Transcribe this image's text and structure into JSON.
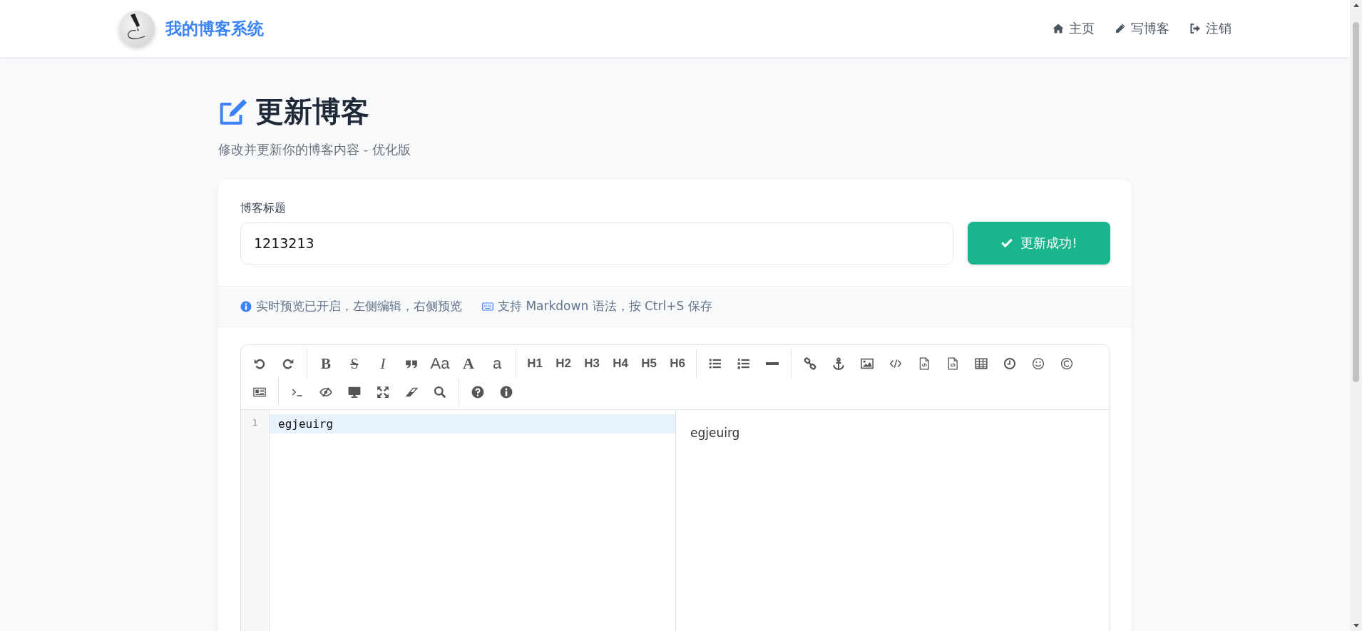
{
  "header": {
    "brand": "我的博客系统",
    "nav": [
      {
        "kind": "home",
        "label": "主页"
      },
      {
        "kind": "pencil",
        "label": "写博客"
      },
      {
        "kind": "signout",
        "label": "注销"
      }
    ]
  },
  "page": {
    "title": "更新博客",
    "subtitle": "修改并更新你的博客内容 - 优化版"
  },
  "form": {
    "title_label": "博客标题",
    "title_value": "1213213",
    "submit_button": "更新成功!"
  },
  "tips": [
    {
      "kind": "info",
      "text": "实时预览已开启，左侧编辑，右侧预览"
    },
    {
      "kind": "keyboard",
      "text": "支持 Markdown 语法，按 Ctrl+S 保存"
    }
  ],
  "editor": {
    "toolbar": [
      [
        {
          "kind": "undo"
        },
        {
          "kind": "redo"
        }
      ],
      [
        {
          "kind": "bold",
          "label": "B"
        },
        {
          "kind": "strike",
          "label": "S"
        },
        {
          "kind": "italic",
          "label": "I"
        },
        {
          "kind": "quote"
        },
        {
          "kind": "text",
          "label": "Aa"
        },
        {
          "kind": "serif",
          "label": "A"
        },
        {
          "kind": "text",
          "label": "a"
        }
      ],
      [
        {
          "kind": "heading",
          "label": "H1"
        },
        {
          "kind": "heading",
          "label": "H2"
        },
        {
          "kind": "heading",
          "label": "H3"
        },
        {
          "kind": "heading",
          "label": "H4"
        },
        {
          "kind": "heading",
          "label": "H5"
        },
        {
          "kind": "heading",
          "label": "H6"
        }
      ],
      [
        {
          "kind": "ul"
        },
        {
          "kind": "ol"
        },
        {
          "kind": "hr"
        }
      ],
      [
        {
          "kind": "link"
        },
        {
          "kind": "anchor"
        },
        {
          "kind": "image"
        },
        {
          "kind": "code"
        },
        {
          "kind": "filecode"
        },
        {
          "kind": "filecode"
        },
        {
          "kind": "table"
        },
        {
          "kind": "clock"
        },
        {
          "kind": "smiley"
        },
        {
          "kind": "copyright"
        },
        {
          "kind": "newspaper"
        }
      ],
      [
        {
          "kind": "terminal"
        },
        {
          "kind": "eyeslash"
        },
        {
          "kind": "desktop"
        },
        {
          "kind": "expand"
        },
        {
          "kind": "eraser"
        },
        {
          "kind": "search"
        }
      ],
      [
        {
          "kind": "question"
        },
        {
          "kind": "info"
        }
      ]
    ],
    "lines": [
      {
        "number": "1",
        "text": "egjeuirg",
        "selected": true
      }
    ],
    "preview": "egjeuirg"
  }
}
